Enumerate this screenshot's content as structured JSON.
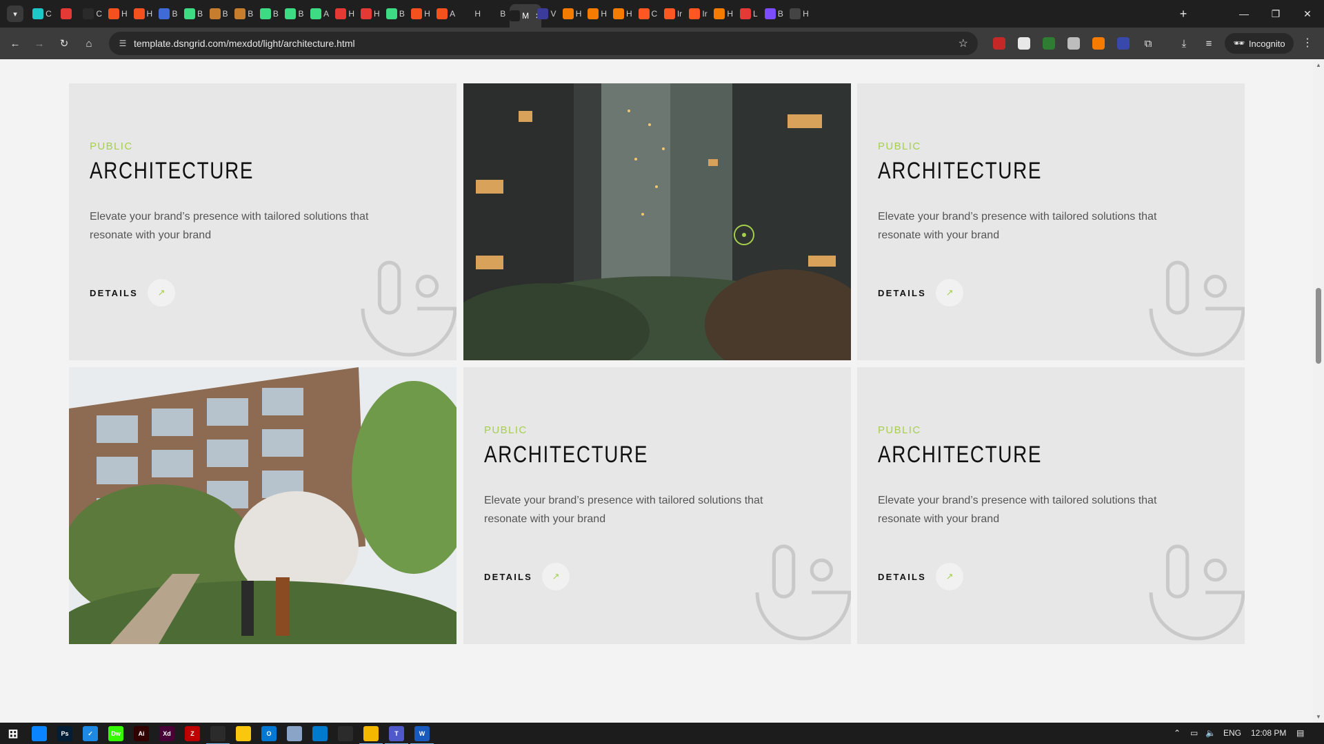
{
  "browser": {
    "tabs": [
      {
        "letter": "C",
        "fav_color": "#1ec8c8"
      },
      {
        "letter": "",
        "fav_color": "#e53935",
        "has_audio": true
      },
      {
        "letter": "C",
        "fav_color": "#2a2a2a"
      },
      {
        "letter": "H",
        "fav_color": "#f4511e"
      },
      {
        "letter": "H",
        "fav_color": "#f4511e"
      },
      {
        "letter": "B",
        "fav_color": "#3f6ad8"
      },
      {
        "letter": "B",
        "fav_color": "#3ddc84"
      },
      {
        "letter": "B",
        "fav_color": "#c77d2e"
      },
      {
        "letter": "B",
        "fav_color": "#c77d2e"
      },
      {
        "letter": "B",
        "fav_color": "#3ddc84"
      },
      {
        "letter": "B",
        "fav_color": "#3ddc84"
      },
      {
        "letter": "A",
        "fav_color": "#3ddc84"
      },
      {
        "letter": "H",
        "fav_color": "#e53935"
      },
      {
        "letter": "H",
        "fav_color": "#e53935"
      },
      {
        "letter": "B",
        "fav_color": "#3ddc84"
      },
      {
        "letter": "H",
        "fav_color": "#f4511e"
      },
      {
        "letter": "A",
        "fav_color": "#f4511e"
      },
      {
        "letter": "H",
        "fav_color": "#1f1f1f"
      },
      {
        "letter": "B",
        "fav_color": "#1f1f1f"
      },
      {
        "letter": "M",
        "fav_color": "#1f1f1f",
        "active": true
      },
      {
        "letter": "V",
        "fav_color": "#3b3b9a"
      },
      {
        "letter": "H",
        "fav_color": "#f57c00"
      },
      {
        "letter": "H",
        "fav_color": "#f57c00"
      },
      {
        "letter": "H",
        "fav_color": "#f57c00"
      },
      {
        "letter": "C",
        "fav_color": "#ff5722"
      },
      {
        "letter": "Ir",
        "fav_color": "#ff5722"
      },
      {
        "letter": "Ir",
        "fav_color": "#ff5722"
      },
      {
        "letter": "H",
        "fav_color": "#f57c00"
      },
      {
        "letter": "L",
        "fav_color": "#e53935"
      },
      {
        "letter": "B",
        "fav_color": "#7c4dff"
      },
      {
        "letter": "H",
        "fav_color": "#444444"
      }
    ],
    "url": "template.dsngrid.com/mexdot/light/architecture.html",
    "incognito_label": "Incognito",
    "icons": {
      "back": "back-arrow-icon",
      "forward": "forward-arrow-icon",
      "reload": "reload-icon",
      "home": "home-icon",
      "site_info": "site-info-icon",
      "bookmark": "star-icon",
      "extensions": "puzzle-icon",
      "downloads": "download-icon",
      "media": "media-queue-icon",
      "menu": "kebab-menu-icon"
    }
  },
  "page": {
    "accent_color": "#a6cf4c",
    "cards": [
      {
        "category": "PUBLIC",
        "title": "ARCHITECTURE",
        "description": "Elevate your brand’s presence with tailored solutions that resonate with your brand",
        "details_label": "DETAILS"
      },
      {
        "category": "PUBLIC",
        "title": "ARCHITECTURE",
        "description": "Elevate your brand’s presence with tailored solutions that resonate with your brand",
        "details_label": "DETAILS"
      },
      {
        "category": "PUBLIC",
        "title": "ARCHITECTURE",
        "description": "Elevate your brand’s presence with tailored solutions that resonate with your brand",
        "details_label": "DETAILS"
      },
      {
        "category": "PUBLIC",
        "title": "ARCHITECTURE",
        "description": "Elevate your brand’s presence with tailored solutions that resonate with your brand",
        "details_label": "DETAILS"
      }
    ],
    "images": [
      {
        "name": "foggy-towers-photo"
      },
      {
        "name": "garden-residence-photo"
      }
    ]
  },
  "taskbar": {
    "apps": [
      {
        "label": "",
        "color": "#0a84ff",
        "name": "edge"
      },
      {
        "label": "Ps",
        "color": "#001e36",
        "name": "photoshop"
      },
      {
        "label": "✓",
        "color": "#1e88e5",
        "name": "todo"
      },
      {
        "label": "Dw",
        "color": "#35fa00",
        "name": "dreamweaver"
      },
      {
        "label": "Ai",
        "color": "#330000",
        "name": "illustrator"
      },
      {
        "label": "Xd",
        "color": "#470137",
        "name": "xd"
      },
      {
        "label": "Z",
        "color": "#bf0000",
        "name": "filezilla"
      },
      {
        "label": "",
        "color": "#2b2b2b",
        "name": "chrome-running",
        "running": true
      },
      {
        "label": "",
        "color": "#f9c80e",
        "name": "sticky-notes"
      },
      {
        "label": "O",
        "color": "#0078d4",
        "name": "outlook"
      },
      {
        "label": "",
        "color": "#8aa4c8",
        "name": "notepad"
      },
      {
        "label": "",
        "color": "#007acc",
        "name": "vscode"
      },
      {
        "label": "",
        "color": "#2b2b2b",
        "name": "chrome"
      },
      {
        "label": "",
        "color": "#f3b700",
        "name": "file-explorer",
        "running": true
      },
      {
        "label": "T",
        "color": "#5059c9",
        "name": "teams",
        "running": true
      },
      {
        "label": "W",
        "color": "#185abd",
        "name": "word",
        "running": true
      }
    ],
    "language": "ENG",
    "time": "12:08 PM"
  }
}
